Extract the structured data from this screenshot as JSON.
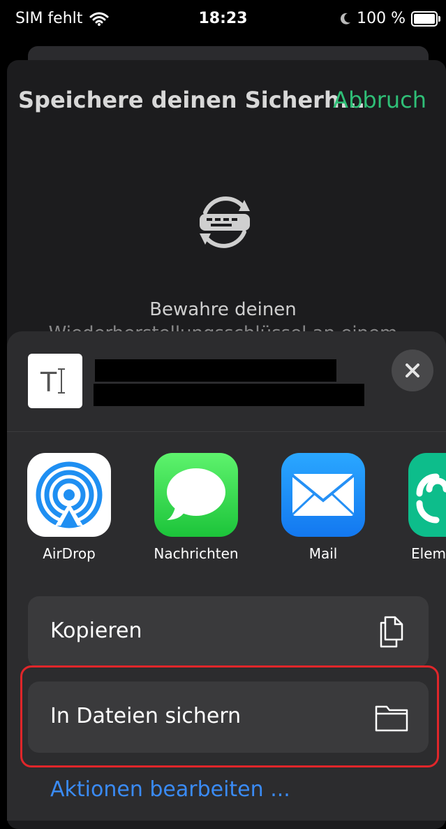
{
  "status_bar": {
    "carrier": "SIM fehlt",
    "time": "18:23",
    "battery": "100 %",
    "icons": [
      "wifi-icon",
      "moon-icon",
      "battery-icon"
    ]
  },
  "background_page": {
    "title": "Speichere deinen Sicherh...",
    "cancel_label": "Abbruch",
    "body_line1": "Bewahre deinen",
    "body_line2": "Wiederherstellungsschlüssel an einem",
    "icon": "key-sync-icon"
  },
  "share_sheet": {
    "preview_icon": "text-document-icon",
    "close_icon": "close-icon",
    "apps": [
      {
        "label": "AirDrop",
        "icon": "airdrop-icon"
      },
      {
        "label": "Nachrichten",
        "icon": "messages-icon"
      },
      {
        "label": "Mail",
        "icon": "mail-icon"
      },
      {
        "label": "Elem",
        "icon": "element-icon"
      }
    ],
    "actions": [
      {
        "label": "Kopieren",
        "icon": "copy-icon"
      },
      {
        "label": "In Dateien sichern",
        "icon": "folder-icon"
      }
    ],
    "edit_actions_label": "Aktionen bearbeiten ..."
  },
  "colors": {
    "accent_green": "#2fbf77",
    "link_blue": "#3a8bf5",
    "highlight_red": "#e0262a"
  }
}
